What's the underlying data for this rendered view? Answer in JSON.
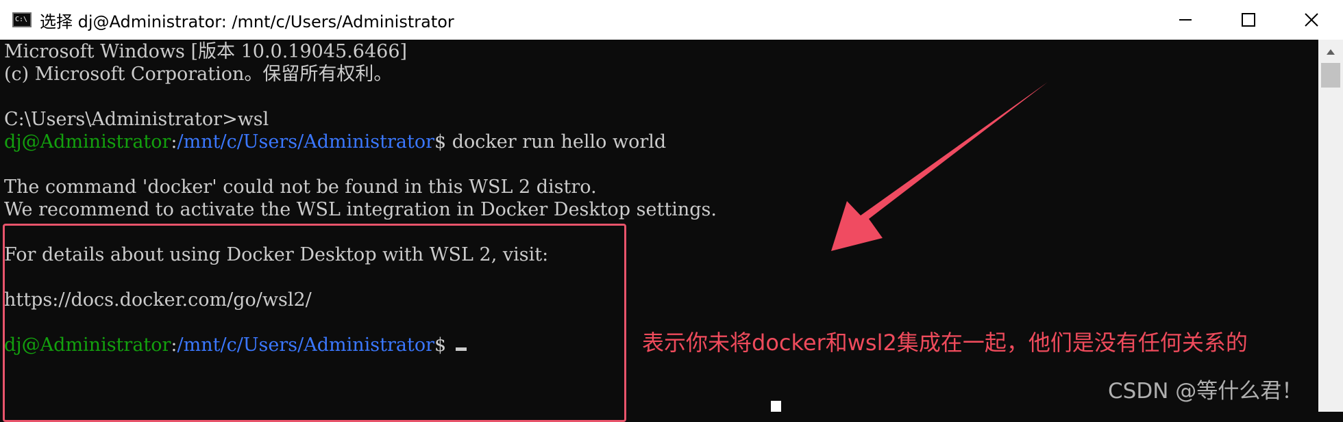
{
  "window": {
    "title": "选择 dj@Administrator: /mnt/c/Users/Administrator",
    "icon_label": "C:\\",
    "icon": "console-icon",
    "controls": [
      "minimize-icon",
      "maximize-icon",
      "close-icon"
    ]
  },
  "terminal": {
    "lines": [
      "Microsoft Windows [版本 10.0.19045.6466]",
      "(c) Microsoft Corporation。保留所有权利。",
      "",
      "C:\\Users\\Administrator>wsl",
      "",
      "",
      "The command 'docker' could not be found in this WSL 2 distro.",
      "We recommend to activate the WSL integration in Docker Desktop settings.",
      "",
      "For details about using Docker Desktop with WSL 2, visit:",
      "",
      "https://docs.docker.com/go/wsl2/"
    ],
    "prompt1": {
      "user": "dj@Administrator",
      "sep": ":",
      "path": "/mnt/c/Users/Administrator",
      "symbol": "$",
      "command": " docker run hello world"
    },
    "prompt2": {
      "user": "dj@Administrator",
      "sep": ":",
      "path": "/mnt/c/Users/Administrator",
      "symbol": "$"
    }
  },
  "annotation": {
    "text": "表示你未将docker和wsl2集成在一起，他们是没有任何关系的",
    "color": "#ef4b5c"
  },
  "watermark": "CSDN @等什么君！",
  "colors": {
    "terminal_bg": "#0c0c0c",
    "terminal_fg": "#cccccc",
    "prompt_user": "#13a10e",
    "prompt_path": "#3b78ff",
    "annotation": "#e8546b"
  }
}
